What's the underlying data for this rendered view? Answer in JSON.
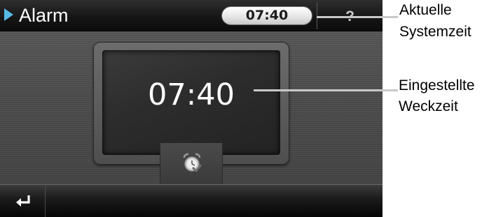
{
  "header": {
    "title": "Alarm",
    "current_time": "07:40",
    "help_label": "?"
  },
  "main": {
    "alarm_time": "07:40"
  },
  "annotations": {
    "current_time_line1": "Aktuelle",
    "current_time_line2": "Systemzeit",
    "alarm_time_line1": "Eingestellte",
    "alarm_time_line2": "Weckzeit"
  },
  "icons": {
    "title": "play-arrow-icon",
    "alarm_button": "alarm-clock-icon",
    "back_button": "return-arrow-icon"
  },
  "colors": {
    "accent": "#58b8e8",
    "topbar": "#141414",
    "background": "#4a4a4a"
  }
}
